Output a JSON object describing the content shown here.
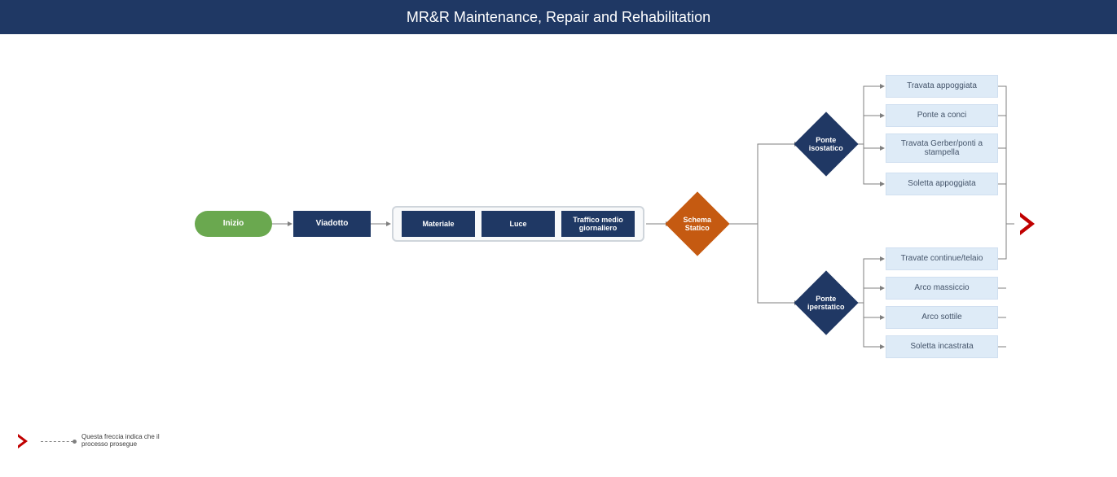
{
  "header": {
    "title": "MR&R Maintenance, Repair and Rehabilitation"
  },
  "flow": {
    "start": "Inizio",
    "viadotto": "Viadotto",
    "container": {
      "materiale": "Materiale",
      "luce": "Luce",
      "traffico": "Traffico medio giornaliero"
    },
    "schema": "Schema Statico",
    "isostatico": "Ponte isostatico",
    "iperstatico": "Ponte iperstatico",
    "iso_leaves": {
      "a": "Travata appoggiata",
      "b": "Ponte a conci",
      "c": "Travata Gerber/ponti a stampella",
      "d": "Soletta appoggiata"
    },
    "iper_leaves": {
      "a": "Travate continue/telaio",
      "b": "Arco massiccio",
      "c": "Arco sottile",
      "d": "Soletta incastrata"
    }
  },
  "legend": {
    "text": "Questa freccia indica che il processo prosegue"
  }
}
